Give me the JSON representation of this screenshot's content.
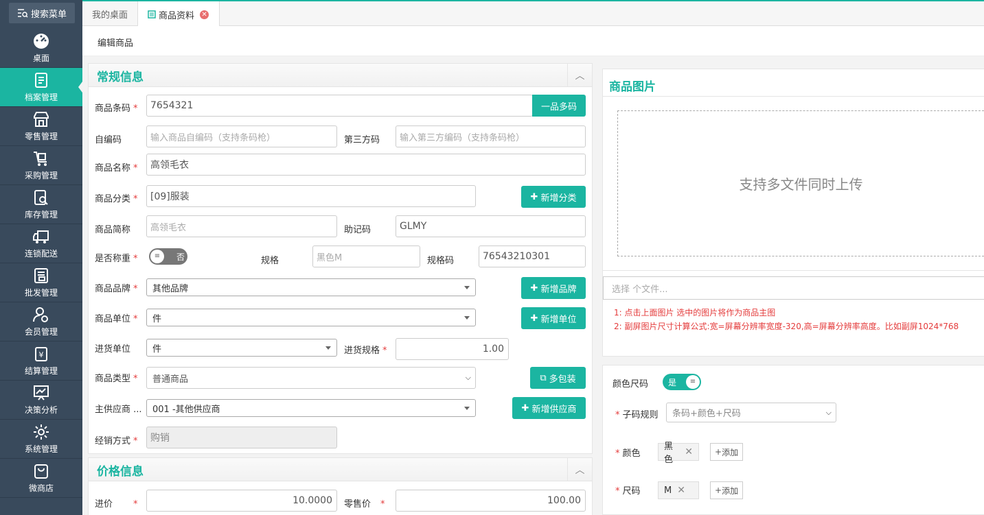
{
  "sidebar": {
    "search_label": "搜索菜单",
    "items": [
      {
        "label": "桌面",
        "icon": "dashboard-icon"
      },
      {
        "label": "档案管理",
        "icon": "archive-icon"
      },
      {
        "label": "零售管理",
        "icon": "store-icon"
      },
      {
        "label": "采购管理",
        "icon": "cart-icon"
      },
      {
        "label": "库存管理",
        "icon": "inventory-icon"
      },
      {
        "label": "连锁配送",
        "icon": "truck-icon"
      },
      {
        "label": "批发管理",
        "icon": "wholesale-icon"
      },
      {
        "label": "会员管理",
        "icon": "member-icon"
      },
      {
        "label": "结算管理",
        "icon": "settlement-icon"
      },
      {
        "label": "决策分析",
        "icon": "chart-icon"
      },
      {
        "label": "系统管理",
        "icon": "gear-icon"
      },
      {
        "label": "微商店",
        "icon": "bag-icon"
      }
    ],
    "active_index": 1
  },
  "tabs": [
    {
      "label": "我的桌面"
    },
    {
      "label": "商品资料",
      "icon": "list-icon",
      "closable": true
    }
  ],
  "subheader": {
    "title": "编辑商品"
  },
  "general": {
    "title": "常规信息",
    "barcode_label": "商品条码",
    "barcode_value": "7654321",
    "multi_code_button": "一品多码",
    "self_code_label": "自编码",
    "self_code_placeholder": "输入商品自编码（支持条码枪）",
    "third_code_label": "第三方码",
    "third_code_placeholder": "输入第三方编码（支持条码枪）",
    "name_label": "商品名称",
    "name_value": "高领毛衣",
    "category_label": "商品分类",
    "category_value": "[09]服装",
    "add_category_button": "新增分类",
    "short_name_label": "商品简称",
    "short_name_value": "高领毛衣",
    "mnemonic_label": "助记码",
    "mnemonic_value": "GLMY",
    "weighing_label": "是否称重",
    "weighing_value": "否",
    "spec_label": "规格",
    "spec_value": "黑色M",
    "spec_code_label": "规格码",
    "spec_code_value": "76543210301",
    "brand_label": "商品品牌",
    "brand_value": "其他品牌",
    "add_brand_button": "新增品牌",
    "unit_label": "商品单位",
    "unit_value": "件",
    "add_unit_button": "新增单位",
    "purchase_unit_label": "进货单位",
    "purchase_unit_value": "件",
    "purchase_spec_label": "进货规格",
    "purchase_spec_value": "1.00",
    "type_label": "商品类型",
    "type_value": "普通商品",
    "multi_pack_button": "多包装",
    "supplier_label": "主供应商 ...",
    "supplier_value": "001 -其他供应商",
    "add_supplier_button": "新增供应商",
    "sales_mode_label": "经销方式",
    "sales_mode_value": "购销"
  },
  "price": {
    "title": "价格信息",
    "purchase_label": "进价",
    "purchase_value": "10.0000",
    "retail_label": "零售价",
    "retail_value": "100.00"
  },
  "image": {
    "title": "商品图片",
    "drop_text": "支持多文件同时上传",
    "file_placeholder": "选择 个文件...",
    "note1": "1: 点击上面图片 选中的图片将作为商品主图",
    "note2": "2: 副屏图片尺寸计算公式:宽=屏幕分辨率宽度-320,高=屏幕分辨率高度。比如副屏1024*768"
  },
  "color_size": {
    "label": "颜色尺码",
    "toggle_value": "是",
    "rule_label": "子码规则",
    "rule_value": "条码+颜色+尺码",
    "color_label": "颜色",
    "color_tag": "黑色",
    "size_label": "尺码",
    "size_tag": "M",
    "add_label": "添加"
  },
  "colors": {
    "accent": "#1bb5a1",
    "sidebar": "#394a5c",
    "required": "#e43b3b"
  }
}
